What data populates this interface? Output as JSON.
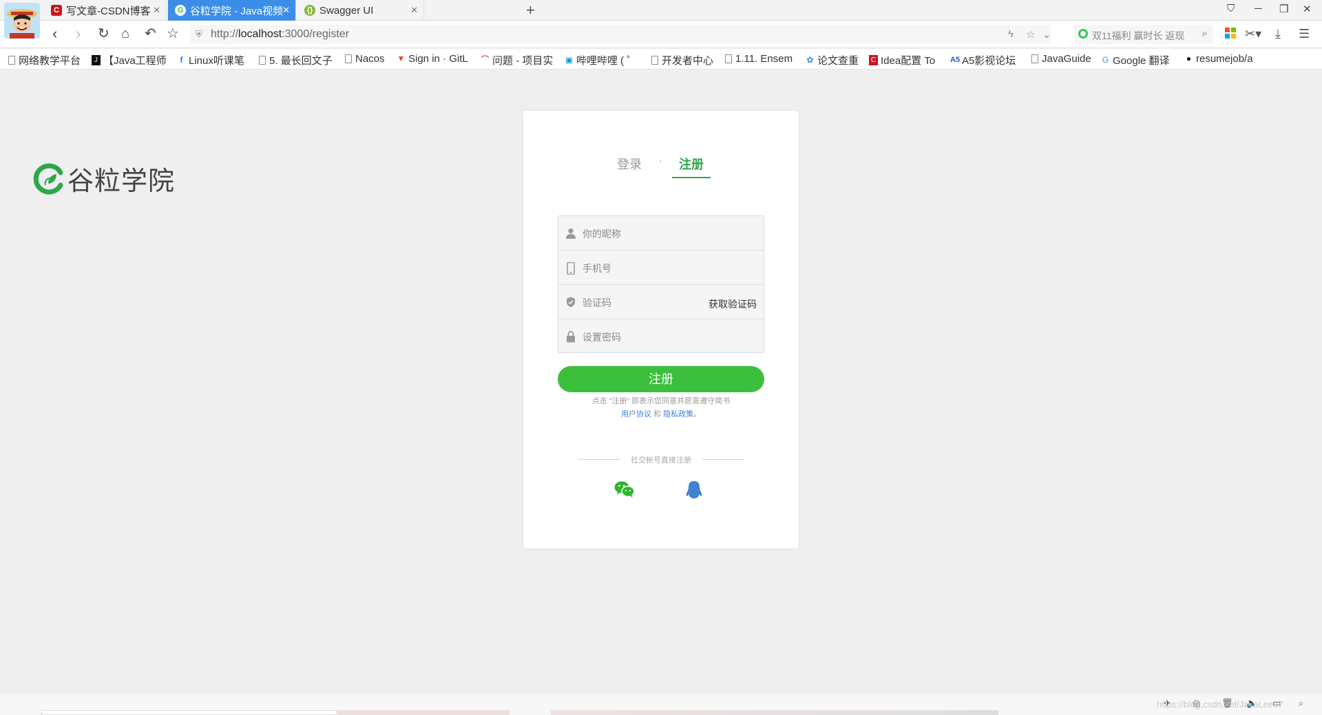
{
  "browser": {
    "tabs": [
      {
        "label": "写文章-CSDN博客",
        "icon": "csdn-icon",
        "active": false
      },
      {
        "label": "谷粒学院 - Java视频|HTM",
        "icon": "guli-icon",
        "active": true
      },
      {
        "label": "Swagger UI",
        "icon": "swagger-icon",
        "active": false
      }
    ],
    "url_prefix": "http://",
    "url_host": "localhost",
    "url_rest": ":3000/register",
    "search_placeholder": "双11福利 赢时长 返现",
    "bookmarks": [
      "网络教学平台",
      "【Java工程师",
      "Linux听课笔",
      "5. 最长回文子",
      "Nacos",
      "Sign in · GitL",
      "问题 - 项目实",
      "哔哩哔哩 ( ゜",
      "开发者中心",
      "1.11. Ensem",
      "论文查重",
      "Idea配置 To",
      "A5影视论坛",
      "JavaGuide",
      "Google 翻译",
      "resumejob/a"
    ]
  },
  "page": {
    "logo_text": "谷粒学院",
    "tab_login": "登录",
    "tab_separator": "·",
    "tab_register": "注册",
    "fields": {
      "nickname_placeholder": "你的昵称",
      "phone_placeholder": "手机号",
      "code_placeholder": "验证码",
      "send_code": "获取验证码",
      "password_placeholder": "设置密码"
    },
    "register_button": "注册",
    "agree_line1": "点击 “注册” 即表示您同意并愿意遵守简书",
    "agree_user_protocol": "用户协议",
    "agree_and": "和",
    "agree_privacy": "隐私政策",
    "agree_end": "。",
    "social_title": "社交帐号直接注册"
  },
  "colors": {
    "accent_green": "#3cbf3c",
    "tab_green": "#2fa54a",
    "link_blue": "#3a7fd5",
    "active_tab": "#3b8ee8"
  },
  "watermark": "https://blog.csdn.net/JavaLee07"
}
